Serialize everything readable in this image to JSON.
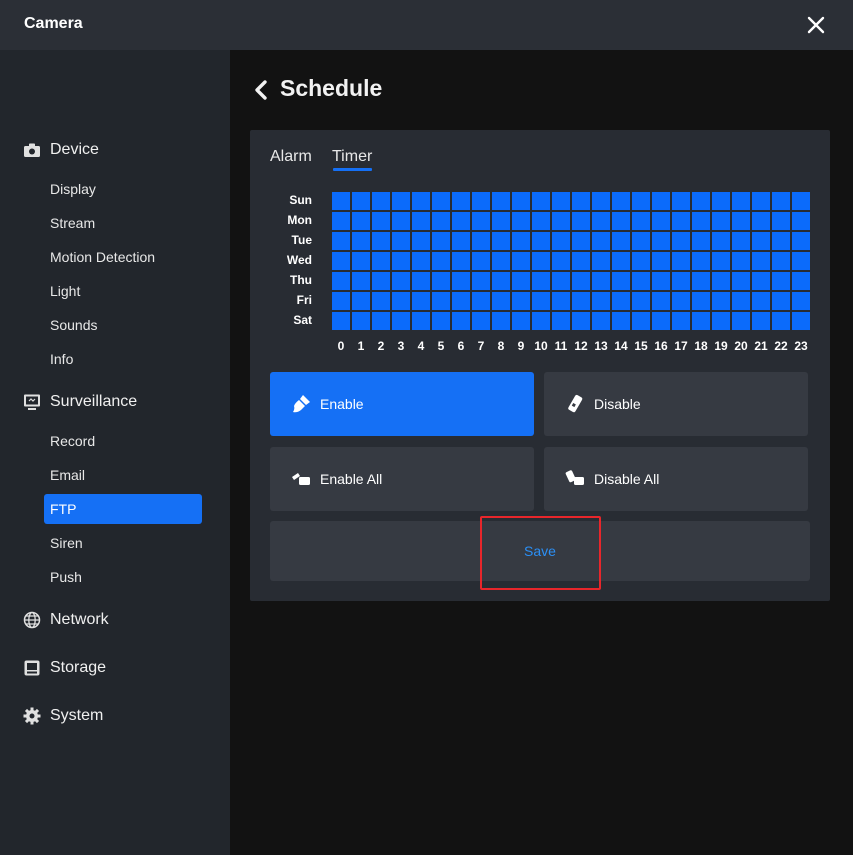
{
  "window": {
    "title": "Camera"
  },
  "icons": {
    "close": "close-icon",
    "back": "chevron-left-icon"
  },
  "colors": {
    "accent": "#1570f5",
    "cell_enabled": "#0b6bfb",
    "save_text": "#2b8ff5",
    "highlight": "#e8262b"
  },
  "sidebar": {
    "sections": [
      {
        "label": "Device",
        "icon": "camera-icon",
        "items": [
          "Display",
          "Stream",
          "Motion Detection",
          "Light",
          "Sounds",
          "Info"
        ]
      },
      {
        "label": "Surveillance",
        "icon": "monitor-icon",
        "items": [
          "Record",
          "Email",
          "FTP",
          "Siren",
          "Push"
        ]
      },
      {
        "label": "Network",
        "icon": "globe-icon",
        "items": []
      },
      {
        "label": "Storage",
        "icon": "storage-icon",
        "items": []
      },
      {
        "label": "System",
        "icon": "gear-icon",
        "items": []
      }
    ],
    "active_item": "FTP"
  },
  "page": {
    "title": "Schedule"
  },
  "tabs": [
    {
      "label": "Alarm",
      "active": false
    },
    {
      "label": "Timer",
      "active": true
    }
  ],
  "schedule": {
    "days": [
      "Sun",
      "Mon",
      "Tue",
      "Wed",
      "Thu",
      "Fri",
      "Sat"
    ],
    "hours": [
      "0",
      "1",
      "2",
      "3",
      "4",
      "5",
      "6",
      "7",
      "8",
      "9",
      "10",
      "11",
      "12",
      "13",
      "14",
      "15",
      "16",
      "17",
      "18",
      "19",
      "20",
      "21",
      "22",
      "23"
    ],
    "all_enabled": true
  },
  "actions": {
    "enable": {
      "label": "Enable",
      "icon": "brush-icon",
      "selected": true
    },
    "disable": {
      "label": "Disable",
      "icon": "eraser-icon",
      "selected": false
    },
    "enable_all": {
      "label": "Enable All",
      "icon": "brush-all-icon"
    },
    "disable_all": {
      "label": "Disable All",
      "icon": "eraser-all-icon"
    },
    "save": {
      "label": "Save"
    }
  }
}
